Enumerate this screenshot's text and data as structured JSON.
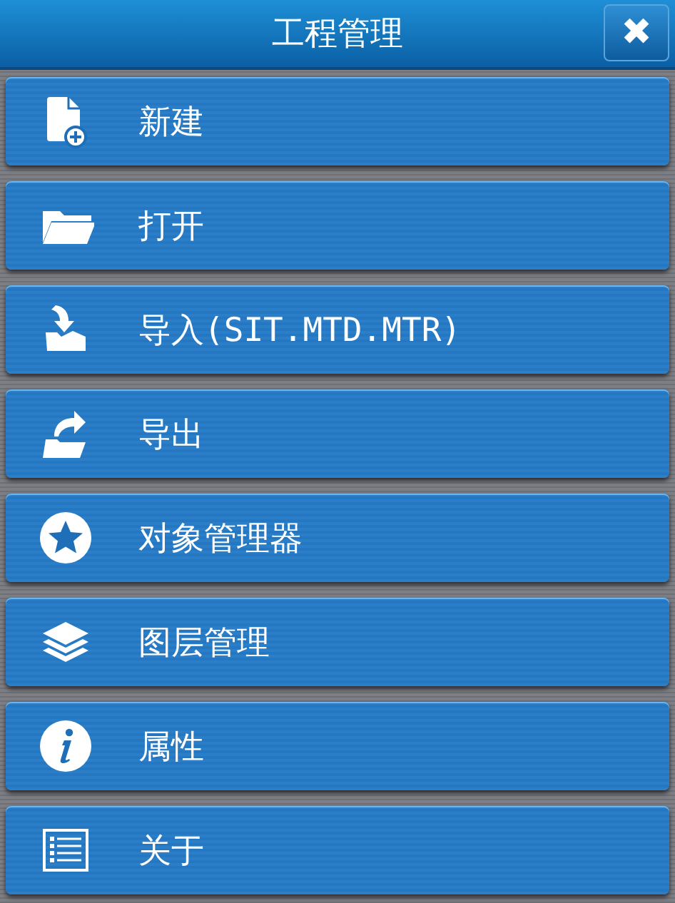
{
  "window": {
    "title": "工程管理",
    "close": "✖"
  },
  "items": [
    {
      "kind": "new",
      "label": "新建"
    },
    {
      "kind": "open",
      "label": "打开"
    },
    {
      "kind": "import",
      "label": "导入(SIT.MTD.MTR)"
    },
    {
      "kind": "export",
      "label": "导出"
    },
    {
      "kind": "star",
      "label": "对象管理器"
    },
    {
      "kind": "layers",
      "label": "图层管理"
    },
    {
      "kind": "info",
      "label": "属性"
    },
    {
      "kind": "list",
      "label": "关于"
    }
  ]
}
